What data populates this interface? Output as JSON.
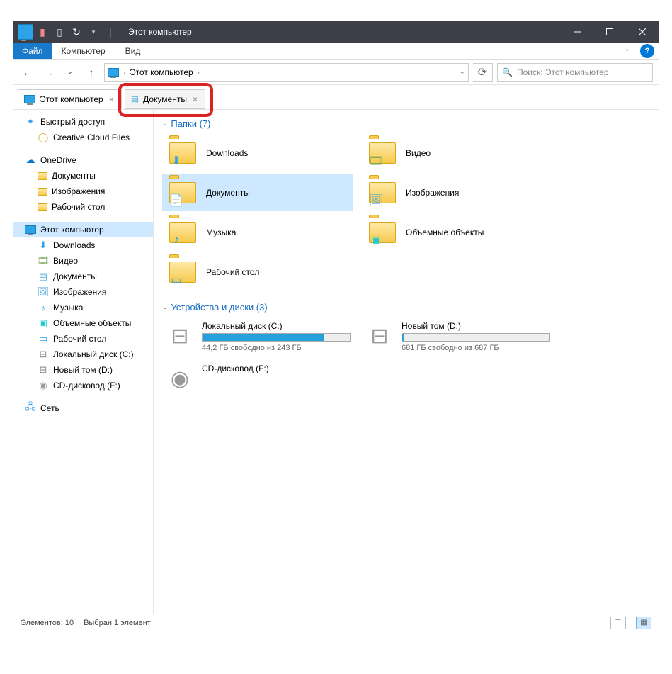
{
  "titlebar": {
    "title": "Этот компьютер"
  },
  "ribbon": {
    "file": "Файл",
    "computer": "Компьютер",
    "view": "Вид"
  },
  "nav": {
    "recent_chevron": "⌄"
  },
  "address": {
    "location": "Этот компьютер",
    "history_chevron": "⌄"
  },
  "search": {
    "placeholder": "Поиск: Этот компьютер"
  },
  "tabs": [
    {
      "label": "Этот компьютер",
      "active": true
    },
    {
      "label": "Документы",
      "active": false
    }
  ],
  "sidebar": {
    "quick": "Быстрый доступ",
    "cc": "Creative Cloud Files",
    "onedrive": "OneDrive",
    "od_docs": "Документы",
    "od_pics": "Изображения",
    "od_desk": "Рабочий стол",
    "thispc": "Этот компьютер",
    "downloads": "Downloads",
    "videos": "Видео",
    "documents": "Документы",
    "pictures": "Изображения",
    "music": "Музыка",
    "objects3d": "Объемные объекты",
    "desktop": "Рабочий стол",
    "localdisk": "Локальный диск (C:)",
    "newvol": "Новый том (D:)",
    "cddrive": "CD-дисковод (F:)",
    "network": "Сеть"
  },
  "groups": {
    "folders_header": "Папки (7)",
    "drives_header": "Устройства и диски (3)"
  },
  "folders": [
    {
      "name": "Downloads",
      "deco": "⬇",
      "color": "#2aa3e8"
    },
    {
      "name": "Видео",
      "deco": "🎞",
      "color": "#7a5"
    },
    {
      "name": "Документы",
      "deco": "📄",
      "color": "#5ad",
      "selected": true
    },
    {
      "name": "Изображения",
      "deco": "🖼",
      "color": "#5ad"
    },
    {
      "name": "Музыка",
      "deco": "♪",
      "color": "#2aa3e8"
    },
    {
      "name": "Объемные объекты",
      "deco": "▣",
      "color": "#2cc"
    },
    {
      "name": "Рабочий стол",
      "deco": "▭",
      "color": "#2aa3e8"
    }
  ],
  "drives": [
    {
      "name": "Локальный диск (C:)",
      "sub": "44,2 ГБ свободно из 243 ГБ",
      "fill": 82,
      "type": "hdd"
    },
    {
      "name": "Новый том (D:)",
      "sub": "681 ГБ свободно из 687 ГБ",
      "fill": 1,
      "type": "hdd"
    },
    {
      "name": "CD-дисковод (F:)",
      "sub": "",
      "fill": null,
      "type": "cd"
    }
  ],
  "status": {
    "count": "Элементов: 10",
    "selected": "Выбран 1 элемент"
  }
}
